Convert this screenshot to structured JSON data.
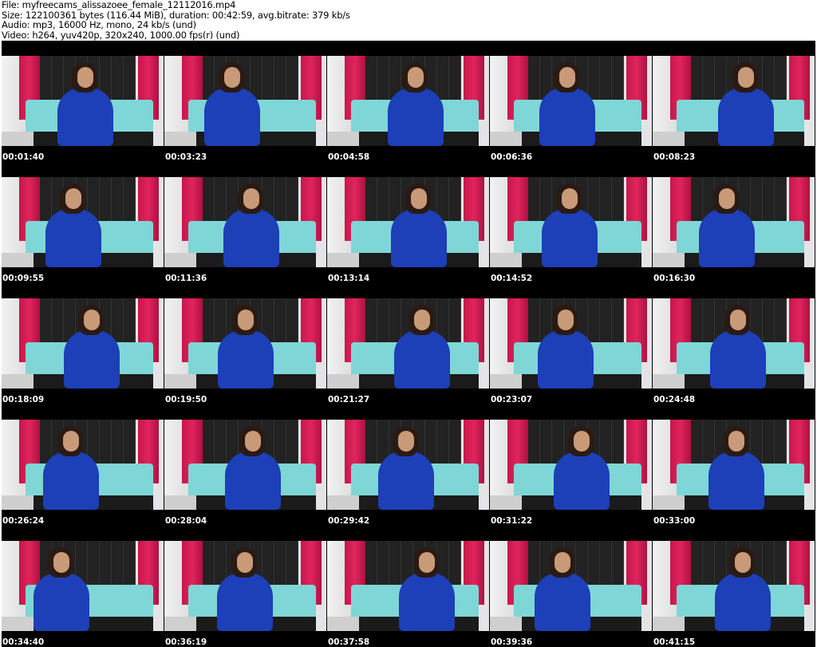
{
  "info": {
    "file": "File: myfreecams_alissazoee_female_12112016.mp4",
    "size": "Size: 122100361 bytes (116.44 MiB), duration: 00:42:59, avg.bitrate: 379 kb/s",
    "audio": "Audio: mp3, 16000 Hz, mono, 24 kb/s (und)",
    "video": "Video: h264, yuv420p, 320x240, 1000.00 fps(r) (und)"
  },
  "timestamps": [
    "00:01:40",
    "00:03:23",
    "00:04:58",
    "00:06:36",
    "00:08:23",
    "00:09:55",
    "00:11:36",
    "00:13:14",
    "00:14:52",
    "00:16:30",
    "00:18:09",
    "00:19:50",
    "00:21:27",
    "00:23:07",
    "00:24:48",
    "00:26:24",
    "00:28:04",
    "00:29:42",
    "00:31:22",
    "00:33:00",
    "00:34:40",
    "00:36:19",
    "00:37:58",
    "00:39:36",
    "00:41:15"
  ]
}
